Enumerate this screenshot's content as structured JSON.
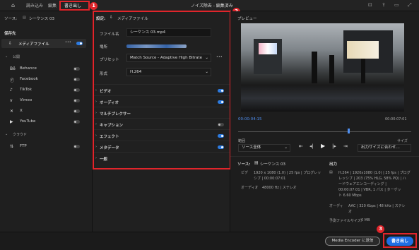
{
  "topbar": {
    "tabs": [
      "読み込み",
      "編集",
      "書き出し"
    ],
    "title": "ノイズ除去 - 編集済み"
  },
  "left": {
    "source_label": "ソース:",
    "source_value": "シーケンス 03",
    "destinations_label": "保存先",
    "media_file_label": "メディアファイル",
    "social_header": "公開",
    "social": [
      "Behance",
      "Facebook",
      "TikTok",
      "Vimeo",
      "X",
      "YouTube"
    ],
    "cloud_header": "クラウド",
    "cloud": [
      "FTP"
    ]
  },
  "settings": {
    "header": "設定:",
    "header_value": "メディアファイル",
    "filename_label": "ファイル名",
    "filename_value": "シーケンス 03.mp4",
    "location_label": "場所",
    "preset_label": "プリセット",
    "preset_value": "Match Source - Adaptive High Bitrate",
    "format_label": "形式",
    "format_value": "H.264",
    "sections": [
      "ビデオ",
      "オーディオ",
      "マルチプレクサー",
      "キャプション",
      "エフェクト",
      "メタデータ",
      "一般"
    ]
  },
  "preview": {
    "label": "プレビュー",
    "time_current": "00:00:04:15",
    "time_total": "00:00:07:01",
    "range_label": "範囲",
    "range_value": "ソース全体",
    "size_label": "サイズ",
    "size_value": "出力サイズに合わせ…"
  },
  "source_info": {
    "label": "ソース:",
    "value": "シーケンス 03",
    "video_key": "ビデ",
    "video_line1": "1920 x 1080 (1.0) | 25 fps | プログレッ",
    "video_line2": "シブ | 00:00:07:01",
    "audio_key": "オーディオ",
    "audio_value": "48000 Hz | ステレオ"
  },
  "output_info": {
    "label": "出力",
    "video_line1": "H.264 | 1920x1080 (1.0) | 25 fps | プログ",
    "video_line2": "レッシブ | 203 (75% HLG, 58% PQ) | ハ",
    "video_line3": "ードウェアエンコーディング |",
    "video_line4": "00:00:07:01 | VBR, 1 パス | ターゲッ",
    "video_line5": "ト 6.60 Mbps",
    "audio_key": "オーディ",
    "audio_line1": "AAC | 320 Kbps | 48 kHz | ステレ",
    "audio_line2": "オ",
    "filesize_label": "予測ファイルサイズ:",
    "filesize_value": "6 MB"
  },
  "bottom": {
    "media_encoder_label": "Media Encoder に送信",
    "export_label": "書き出し"
  },
  "annotations": [
    "1",
    "2",
    "3"
  ]
}
